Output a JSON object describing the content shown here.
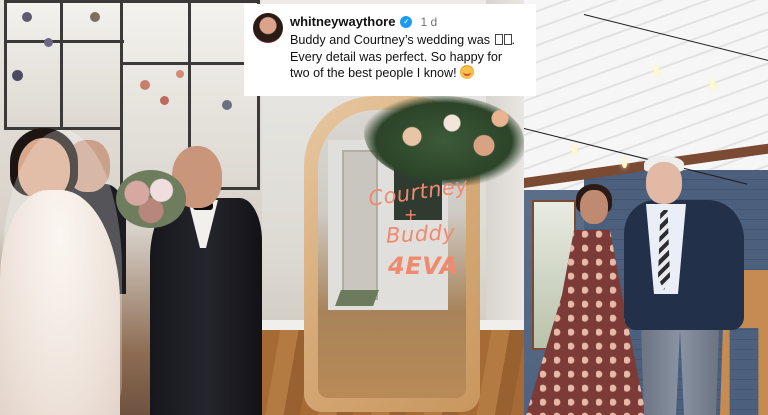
{
  "post": {
    "username": "whitneywaythore",
    "timestamp": "1 d",
    "caption_line1": "Buddy and Courtney’s wedding was",
    "caption_line1_end": ".",
    "caption_line2": "Every detail was perfect. So happy for",
    "caption_line3": "two of the best people I know!",
    "verified_icon": "verified-badge-icon",
    "emoji_icon": "smiling-face-with-hearts-emoji"
  },
  "photos": {
    "middle_sign": {
      "line1": "Courtney",
      "line2": "+",
      "line3": "Buddy",
      "line4": "4EVA"
    }
  },
  "colors": {
    "verified": "#1d9bf0",
    "sign_text": "#f08a6f",
    "caption_bg": "#ffffff"
  }
}
